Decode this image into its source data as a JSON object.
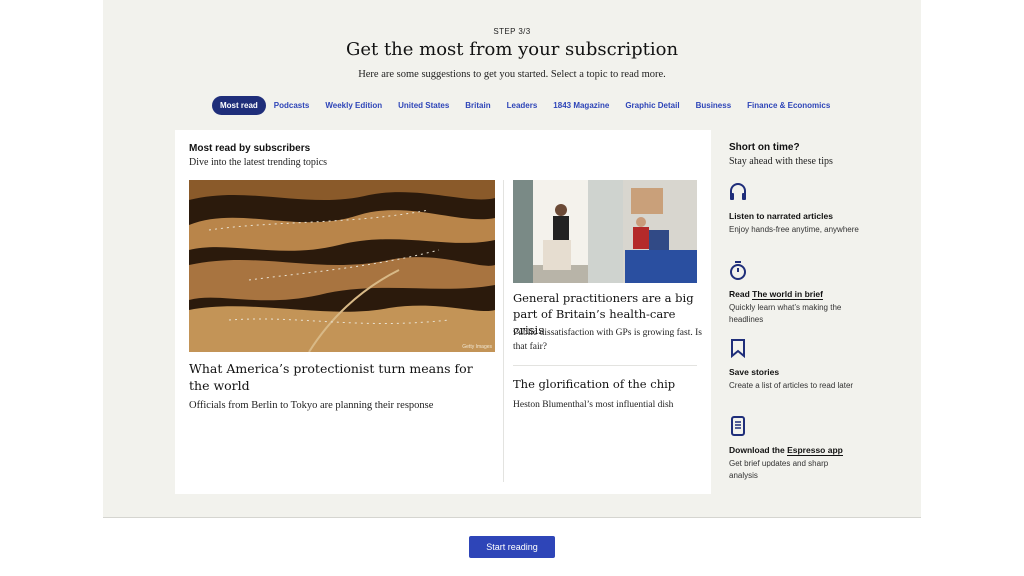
{
  "header": {
    "step": "STEP 3/3",
    "title": "Get the most from your subscription",
    "subtitle": "Here are some suggestions to get you started. Select a topic to read more."
  },
  "tabs": [
    {
      "label": "Most read",
      "active": true
    },
    {
      "label": "Podcasts"
    },
    {
      "label": "Weekly Edition"
    },
    {
      "label": "United States"
    },
    {
      "label": "Britain"
    },
    {
      "label": "Leaders"
    },
    {
      "label": "1843 Magazine"
    },
    {
      "label": "Graphic Detail"
    },
    {
      "label": "Business"
    },
    {
      "label": "Finance & Economics"
    }
  ],
  "card": {
    "title": "Most read by subscribers",
    "subtitle": "Dive into the latest trending topics",
    "main": {
      "image_credit": "Getty Images",
      "headline": "What America’s protectionist turn means for the world",
      "description": "Officials from Berlin to Tokyo are planning their response"
    },
    "side1": {
      "headline": "General practitioners are a big part of Britain’s health-care crisis",
      "description": "Public dissatisfaction with GPs is growing fast. Is that fair?"
    },
    "side2": {
      "headline": "The glorification of the chip",
      "description": "Heston Blumenthal’s most influential dish"
    }
  },
  "tips": {
    "title": "Short on time?",
    "subtitle": "Stay ahead with these tips",
    "items": [
      {
        "icon": "headphones-icon",
        "title": "Listen to narrated articles",
        "description": "Enjoy hands-free anytime, anywhere"
      },
      {
        "icon": "stopwatch-icon",
        "title_prefix": "Read ",
        "title_link": "The world in brief",
        "description": "Quickly learn what’s making the headlines"
      },
      {
        "icon": "bookmark-icon",
        "title": "Save stories",
        "description": "Create a list of articles to read later"
      },
      {
        "icon": "phone-icon",
        "title_prefix": "Download the ",
        "title_link": "Espresso app",
        "description": "Get brief updates and sharp analysis"
      }
    ]
  },
  "footer": {
    "start_label": "Start reading"
  },
  "colors": {
    "accent": "#2e45b8",
    "active_tab": "#1f2e7a",
    "panel_bg": "#f2f2ed"
  }
}
